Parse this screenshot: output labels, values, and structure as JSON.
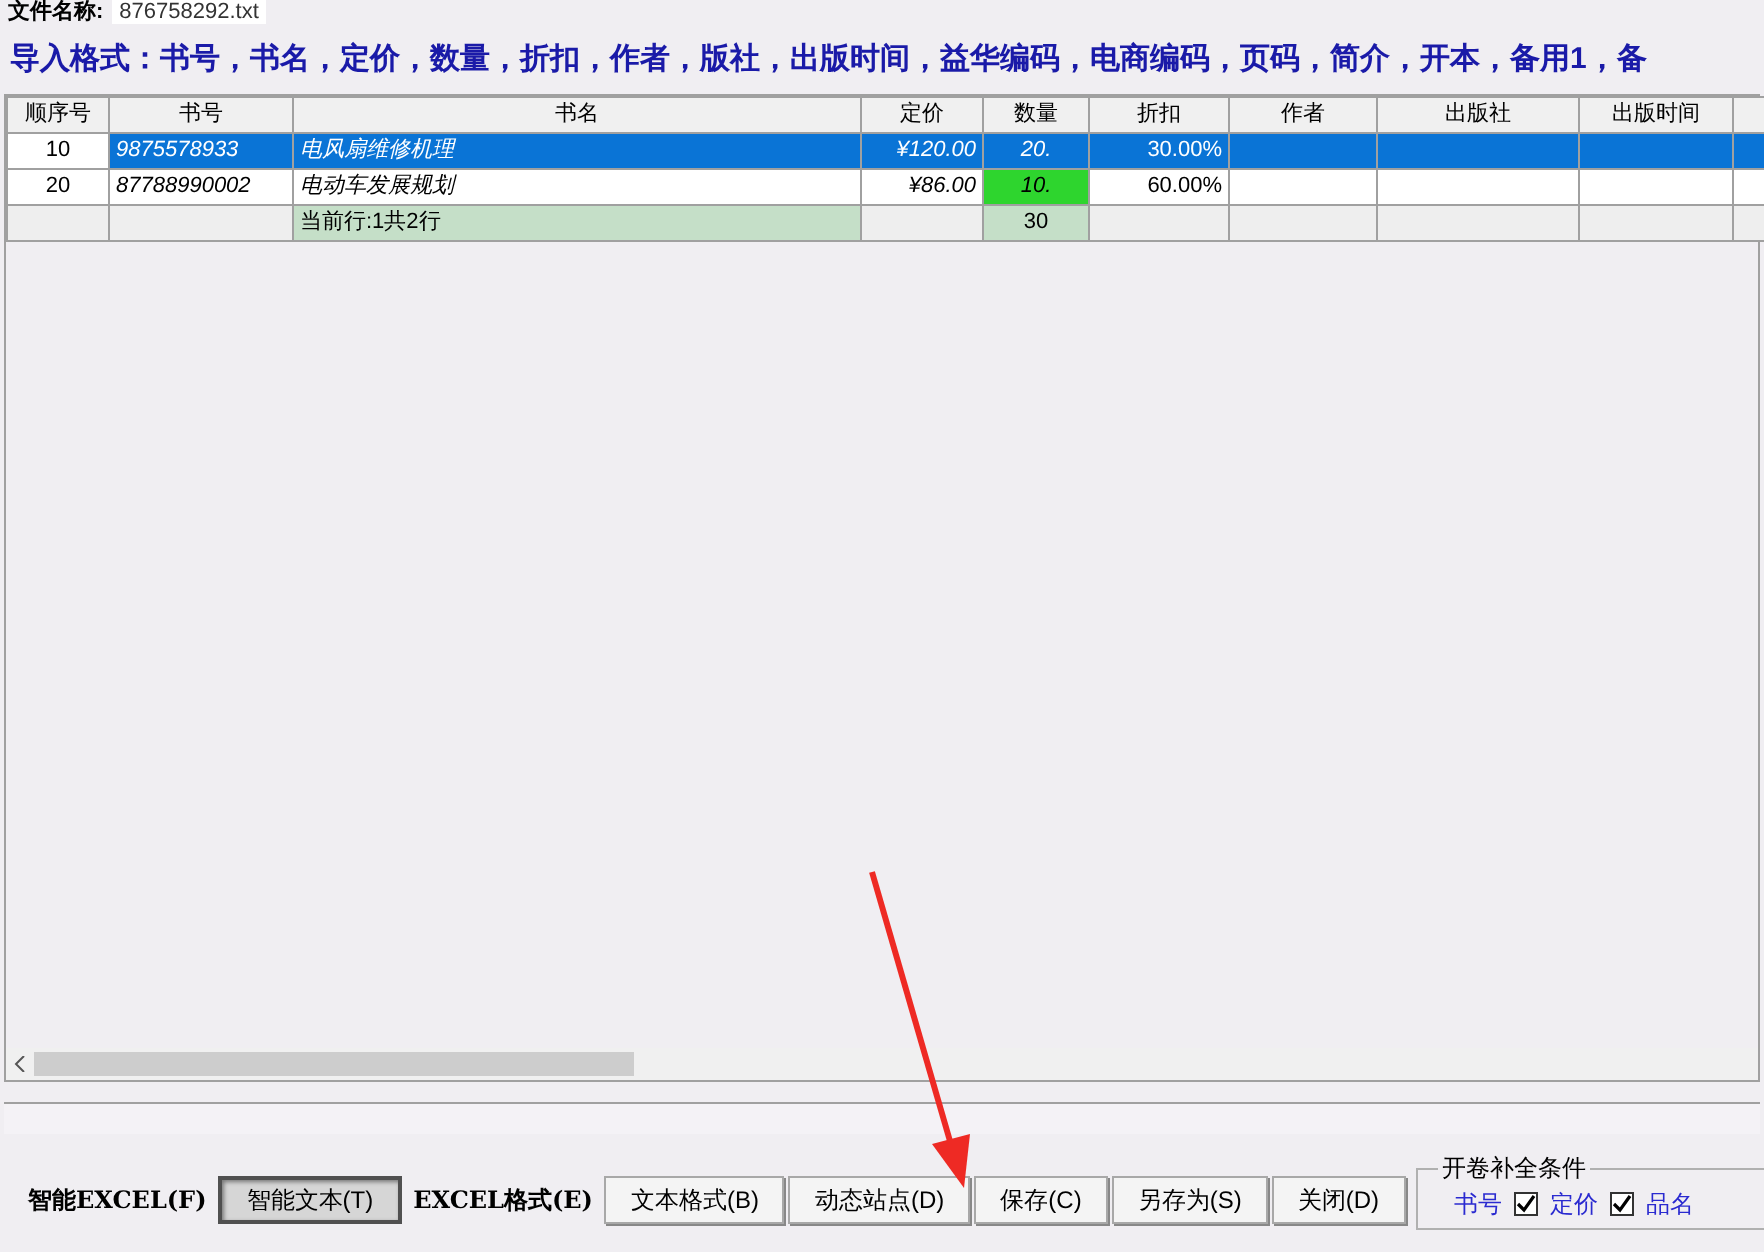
{
  "file": {
    "label": "文件名称:",
    "value": "876758292.txt"
  },
  "import_format": "导入格式：书号，书名，定价，数量，折扣，作者，版社，出版时间，益华编码，电商编码，页码，简介，开本，备用1，备",
  "table": {
    "columns": [
      "顺序号",
      "书号",
      "书名",
      "定价",
      "数量",
      "折扣",
      "作者",
      "出版社",
      "出版时间"
    ],
    "rows": [
      {
        "selected": true,
        "cells": [
          "10",
          "9875578933",
          "电风扇维修机理",
          "¥120.00",
          "20.",
          "30.00%",
          "",
          "",
          ""
        ]
      },
      {
        "selected": false,
        "cells": [
          "20",
          "87788990002",
          "电动车发展规划",
          "¥86.00",
          "10.",
          "60.00%",
          "",
          "",
          ""
        ]
      }
    ],
    "summary": {
      "title": "当前行:1共2行",
      "quantity": "30"
    }
  },
  "buttons": [
    {
      "kind": "label",
      "label": "智能EXCEL(F)"
    },
    {
      "kind": "button",
      "label": "智能文本(T)",
      "selected": true
    },
    {
      "kind": "label",
      "label": "EXCEL格式(E)"
    },
    {
      "kind": "button",
      "label": "文本格式(B)",
      "selected": false
    },
    {
      "kind": "button",
      "label": "动态站点(D)",
      "selected": false
    },
    {
      "kind": "button",
      "label": "保存(C)",
      "selected": false
    },
    {
      "kind": "button",
      "label": "另存为(S)",
      "selected": false
    },
    {
      "kind": "button",
      "label": "关闭(D)",
      "selected": false
    }
  ],
  "conditions": {
    "title": "开卷补全条件",
    "items": [
      {
        "kind": "label",
        "label": "书号"
      },
      {
        "kind": "checkbox",
        "checked": true
      },
      {
        "kind": "label",
        "label": "定价"
      },
      {
        "kind": "checkbox",
        "checked": true
      },
      {
        "kind": "label",
        "label": "品名"
      }
    ]
  }
}
